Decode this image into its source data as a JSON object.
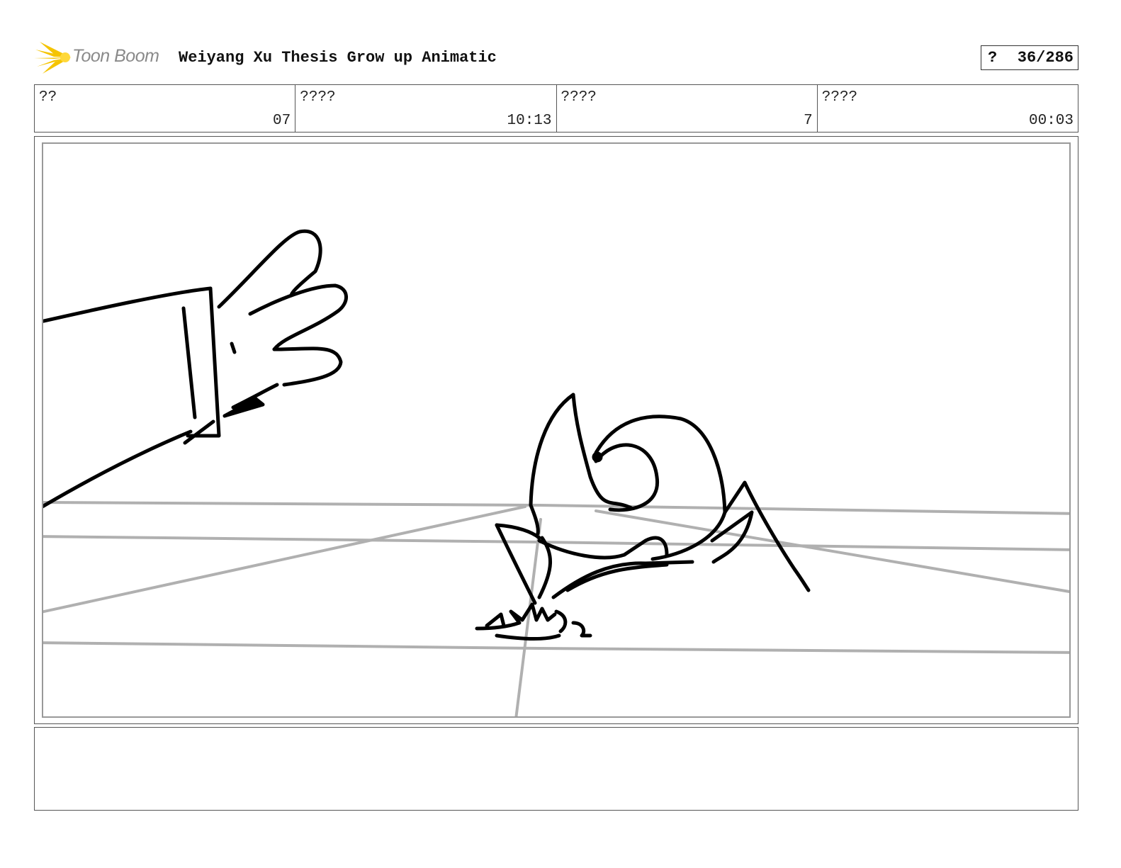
{
  "header": {
    "logo_text": "Toon Boom",
    "project_title": "Weiyang Xu Thesis Grow up Animatic",
    "page_label": "?",
    "page_number": "36/286"
  },
  "info": [
    {
      "label": "??",
      "value": "07"
    },
    {
      "label": "????",
      "value": "10:13"
    },
    {
      "label": "????",
      "value": "7"
    },
    {
      "label": "????",
      "value": "00:03"
    }
  ],
  "panel": {
    "sketch": "storyboard-sketch"
  },
  "notes": {
    "text": ""
  },
  "colors": {
    "logo_star": "#f5c400",
    "logo_text": "#8a8a8a",
    "ink": "#000000",
    "guide_lines": "#b0b0b0"
  }
}
